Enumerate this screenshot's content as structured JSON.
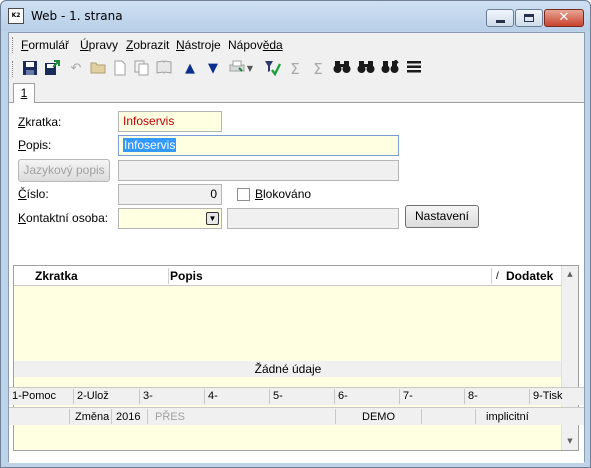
{
  "window": {
    "title": "Web - 1. strana",
    "app_icon_text": "K2",
    "close_glyph": "✕"
  },
  "menu": {
    "items": [
      {
        "key": "F",
        "rest": "ormulář"
      },
      {
        "key": "Ú",
        "rest": "pravy"
      },
      {
        "key": "Z",
        "rest": "obrazit"
      },
      {
        "key": "N",
        "rest": "ástroje"
      },
      {
        "key": "Nápov",
        "rest": "ěda",
        "underline_second": true
      }
    ]
  },
  "toolbar": {
    "icons": [
      "save-icon",
      "save-exit-icon",
      "undo-icon",
      "open-folder-icon",
      "new-document-icon",
      "copy-document-icon",
      "book-icon",
      "arrow-up-icon",
      "arrow-down-icon",
      "print-icon",
      "dropdown-icon",
      "filter-icon",
      "sum-icon",
      "sum-filter-icon",
      "binoculars-icon",
      "binoculars-next-icon",
      "binoculars-replace-icon",
      "menu-lines-icon"
    ]
  },
  "tabs": [
    {
      "label": "1"
    }
  ],
  "form": {
    "zkratka_label_u": "Z",
    "zkratka_label": "kratka:",
    "zkratka_value": "Infoservis",
    "popis_label_u": "P",
    "popis_label": "opis:",
    "popis_value": "Infoservis",
    "jazykovy_button": "Jazykový popis",
    "jazykovy_value": "",
    "cislo_label_u": "Č",
    "cislo_label": "íslo:",
    "cislo_value": "0",
    "blokovano_label_u": "B",
    "blokovano_label": "lokováno",
    "blokovano_checked": false,
    "kontakt_label_u": "K",
    "kontakt_label": "ontaktní osoba:",
    "kontakt_value": "",
    "kontakt_name": "",
    "nastaveni_button": "Nastavení"
  },
  "grid": {
    "columns": [
      "Zkratka",
      "Popis",
      "Dodatek"
    ],
    "sort_indicator": "/",
    "empty_text": "Žádné údaje"
  },
  "fkeys": [
    "1-Pomoc",
    "2-Ulož",
    "3-",
    "4-",
    "5-",
    "6-",
    "7-",
    "8-",
    "9-Tisk"
  ],
  "status": {
    "mode": "Změna",
    "year": "2016",
    "overwrite": "PŘES",
    "database": "DEMO",
    "profile": "implicitní"
  },
  "colors": {
    "field_yellow": "#ffffe1",
    "selection_blue": "#3399ff",
    "close_red": "#c8432c"
  }
}
